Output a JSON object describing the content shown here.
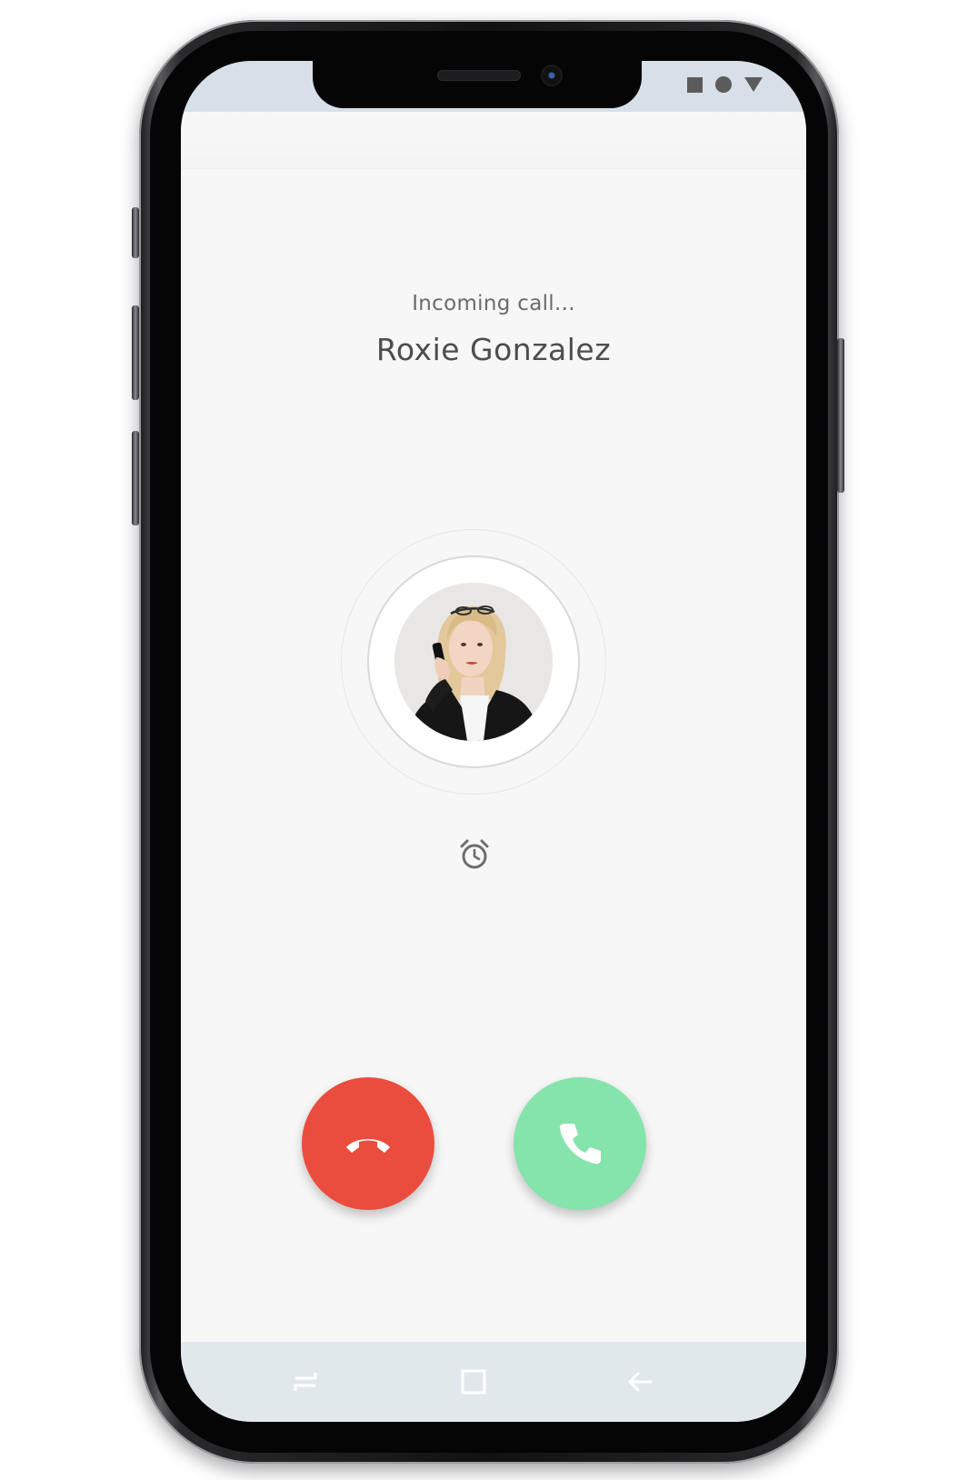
{
  "call": {
    "status_text": "Incoming call...",
    "caller_name": "Roxie Gonzalez"
  },
  "status_bar": {
    "icons": [
      "square-icon",
      "circle-icon",
      "triangle-icon"
    ]
  },
  "actions": {
    "remind_icon": "alarm-clock-icon",
    "decline_icon": "hang-up-icon",
    "accept_icon": "phone-icon"
  },
  "nav_bar": {
    "icons": [
      "recents-icon",
      "home-square-icon",
      "back-arrow-icon"
    ]
  },
  "colors": {
    "decline": "#ea4d3e",
    "accept": "#84e4ab",
    "screen_background": "#f7f7f7",
    "status_bar": "#d7dfe8",
    "nav_bar": "#e1e8ec"
  }
}
